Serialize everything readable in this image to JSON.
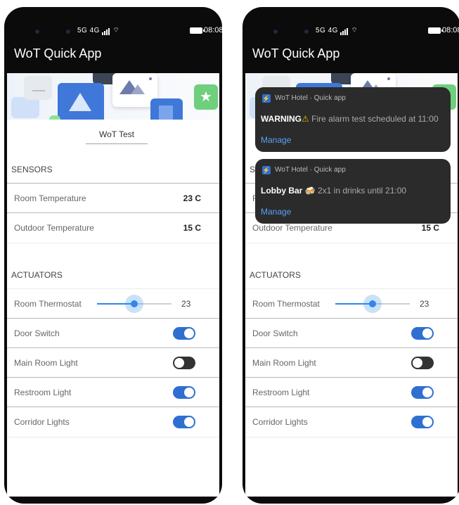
{
  "status_bar": {
    "signal": "5G 4G",
    "time": "08:08"
  },
  "app": {
    "title": "WoT Quick App"
  },
  "input": {
    "value": "WoT Test"
  },
  "sensors": {
    "heading": "SENSORS",
    "items": [
      {
        "label": "Room Temperature",
        "value": "23 C"
      },
      {
        "label": "Outdoor Temperature",
        "value": "15 C"
      }
    ]
  },
  "actuators": {
    "heading": "ACTUATORS",
    "thermostat": {
      "label": "Room Thermostat",
      "value": "23",
      "level": 0.5
    },
    "switches": [
      {
        "label": "Door Switch",
        "on": true
      },
      {
        "label": "Main Room Light",
        "on": false
      },
      {
        "label": "Restroom Light",
        "on": true
      },
      {
        "label": "Corridor Lights",
        "on": true
      }
    ]
  },
  "notifications": [
    {
      "source": "WoT Hotel · Quick app",
      "title": "WARNING",
      "icon": "warning-icon",
      "message": "Fire alarm test scheduled at 11:00",
      "action": "Manage"
    },
    {
      "source": "WoT Hotel · Quick app",
      "title": "Lobby Bar",
      "icon": "drink-icon",
      "message": "2x1 in drinks until 21:00",
      "action": "Manage"
    }
  ],
  "colors": {
    "accent": "#2f6fd1",
    "slider": "#2f88ea",
    "notification_bg": "#2b2b2b"
  }
}
